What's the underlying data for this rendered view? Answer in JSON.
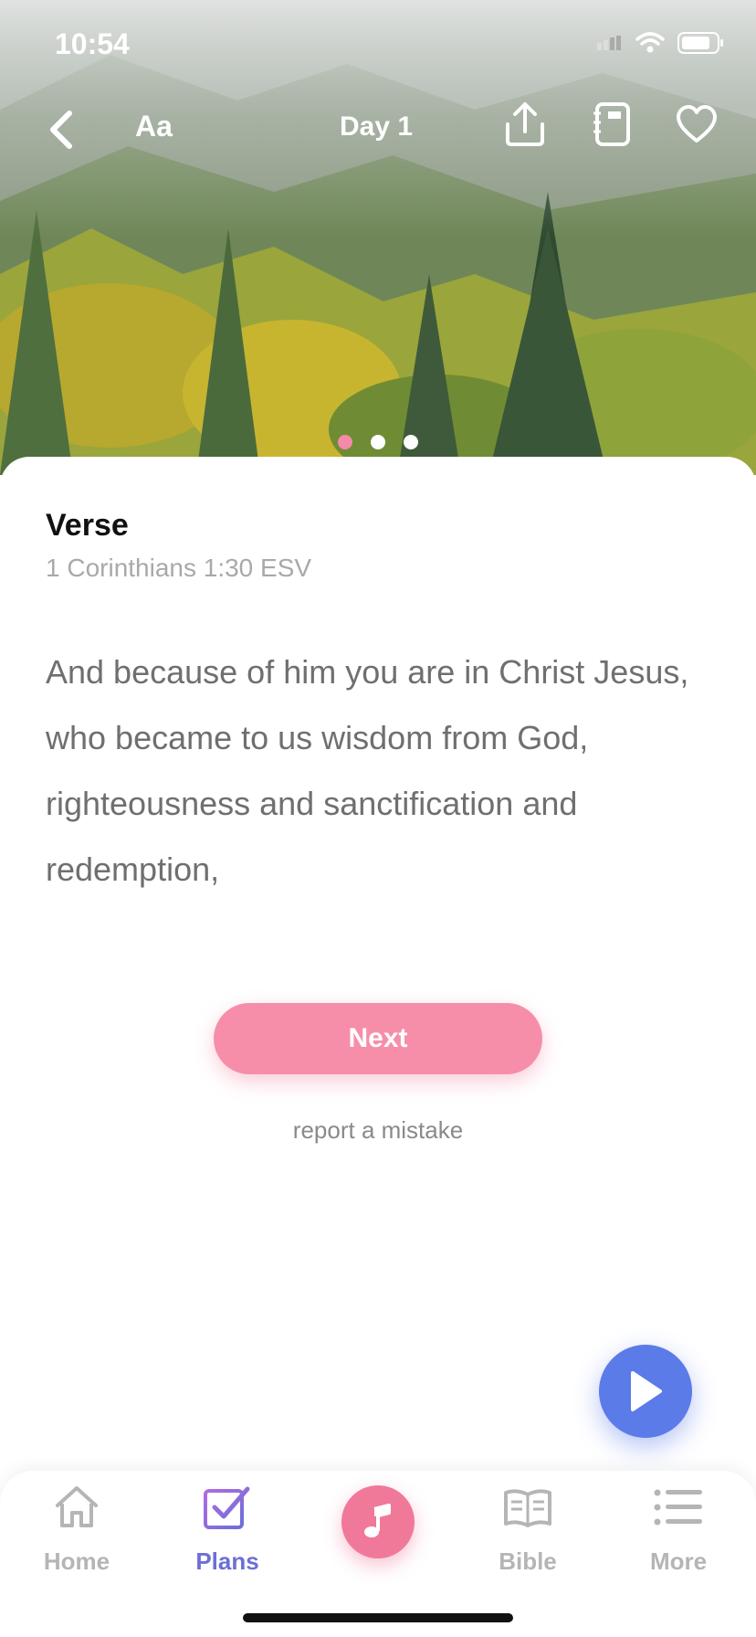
{
  "status_bar": {
    "time": "10:54"
  },
  "nav": {
    "font_label": "Aa",
    "title": "Day 1",
    "icons": [
      "back-icon",
      "share-icon",
      "notes-icon",
      "heart-icon"
    ]
  },
  "pager": {
    "count": 3,
    "active_index": 0
  },
  "content": {
    "section_title": "Verse",
    "reference": "1 Corinthians 1:30 ESV",
    "verse_text": "And because of him you are in Christ Jesus, who became to us wisdom from God, righteousness and sanctification and redemption,"
  },
  "actions": {
    "next_label": "Next",
    "report_label": "report a mistake"
  },
  "tabbar": {
    "items": [
      {
        "label": "Home",
        "icon": "home-icon",
        "active": false
      },
      {
        "label": "Plans",
        "icon": "plans-checkbox-icon",
        "active": true
      },
      {
        "label": "",
        "icon": "music-note-icon",
        "active": false
      },
      {
        "label": "Bible",
        "icon": "open-book-icon",
        "active": false
      },
      {
        "label": "More",
        "icon": "list-icon",
        "active": false
      }
    ]
  },
  "colors": {
    "accent_pink": "#f78ea9",
    "accent_blue": "#5b7be8",
    "active_tab": "#6b6fd6"
  }
}
